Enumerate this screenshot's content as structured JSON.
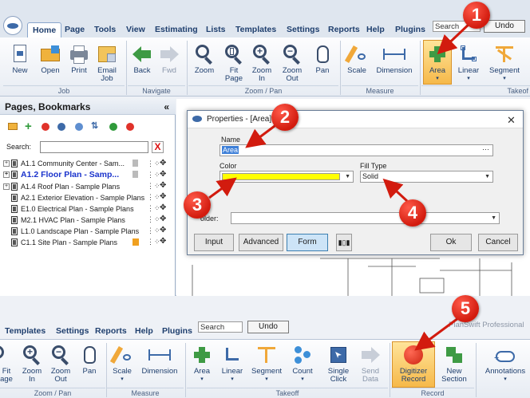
{
  "top_window": {
    "tabs": [
      "Home",
      "Page",
      "Tools",
      "View",
      "Estimating",
      "Lists",
      "Templates",
      "Settings",
      "Reports",
      "Help",
      "Plugins"
    ],
    "search_placeholder": "Search",
    "undo_label": "Undo",
    "ribbon": {
      "job": {
        "label": "Job",
        "buttons": [
          "New",
          "Open",
          "Print",
          "Email Job"
        ]
      },
      "navigate": {
        "label": "Navigate",
        "buttons": [
          "Back",
          "Fwd"
        ]
      },
      "zoom_pan": {
        "label": "Zoom / Pan",
        "buttons": [
          "Zoom",
          "Fit Page",
          "Zoom In",
          "Zoom Out",
          "Pan"
        ]
      },
      "measure": {
        "label": "Measure",
        "buttons": [
          "Scale",
          "Dimension"
        ]
      },
      "takeoff": {
        "label": "Takeof",
        "buttons": [
          "Area",
          "Linear",
          "Segment"
        ]
      }
    }
  },
  "left_panel": {
    "title": "Pages, Bookmarks",
    "collapse": "«",
    "search_label": "Search:",
    "clear": "X",
    "items": [
      {
        "label": "A1.1 Community Center - Sam...",
        "selected": false
      },
      {
        "label": "A1.2 Floor Plan - Samp...",
        "selected": true
      },
      {
        "label": "A1.4 Roof Plan - Sample Plans",
        "selected": false
      },
      {
        "label": "A2.1 Exterior Elevation - Sample Plans",
        "selected": false
      },
      {
        "label": "E1.0 Electrical Plan - Sample Plans",
        "selected": false
      },
      {
        "label": "M2.1 HVAC Plan - Sample Plans",
        "selected": false
      },
      {
        "label": "L1.0 Landscape Plan - Sample Plans",
        "selected": false
      },
      {
        "label": "C1.1 Site Plan - Sample Plans",
        "selected": false
      }
    ]
  },
  "dialog": {
    "title": "Properties - [Area]",
    "close": "✕",
    "name_label": "Name",
    "name_value": "Area",
    "color_label": "Color",
    "color_value": "#ffff00",
    "fill_type_label": "Fill Type",
    "fill_type_value": "Solid",
    "folder_label": "older:",
    "buttons": {
      "input": "Input",
      "advanced": "Advanced",
      "form": "Form",
      "ok": "Ok",
      "cancel": "Cancel"
    }
  },
  "bottom_window": {
    "tabs": [
      "Templates",
      "Settings",
      "Reports",
      "Help",
      "Plugins"
    ],
    "search_placeholder": "Search",
    "undo_label": "Undo",
    "brand": "PlanSwift Professional",
    "ribbon": {
      "zoom_pan": {
        "label": "Zoom / Pan",
        "buttons": [
          "Fit age",
          "Zoom In",
          "Zoom Out",
          "Pan"
        ]
      },
      "measure": {
        "label": "Measure",
        "buttons": [
          "Scale",
          "Dimension"
        ]
      },
      "takeoff": {
        "label": "Takeoff",
        "buttons": [
          "Area",
          "Linear",
          "Segment",
          "Count",
          "Single Click",
          "Send Data"
        ]
      },
      "record": {
        "label": "Record",
        "buttons": [
          "Digitizer Record",
          "New Section"
        ]
      },
      "annotations": {
        "buttons": [
          "Annotations"
        ]
      }
    }
  },
  "annotations": [
    "1",
    "2",
    "3",
    "4",
    "5"
  ],
  "colors": {
    "accent_red": "#d21b0e",
    "ribbon_text": "#1f3f6e",
    "highlight": "#f6b94a"
  }
}
